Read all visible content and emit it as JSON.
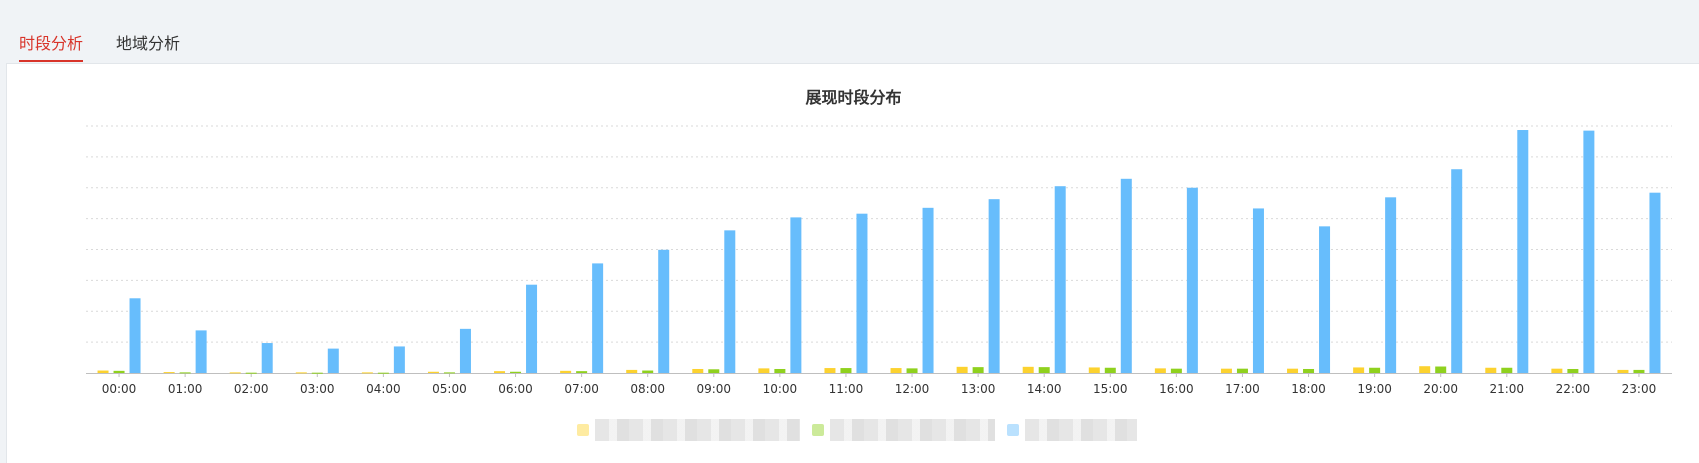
{
  "tabs": [
    {
      "label": "时段分析",
      "active": true
    },
    {
      "label": "地域分析",
      "active": false
    }
  ],
  "colors": {
    "active_tab": "#d8342a",
    "series_yellow": "#fcd22f",
    "series_green": "#8fd11e",
    "series_blue": "#67bdfc",
    "grid": "#d9d9d9",
    "axis": "#bfbfbf"
  },
  "chart_data": {
    "type": "bar",
    "title": "展现时段分布",
    "xlabel": "",
    "ylabel": "",
    "grid": true,
    "legend_position": "bottom",
    "categories": [
      "00:00",
      "01:00",
      "02:00",
      "03:00",
      "04:00",
      "05:00",
      "06:00",
      "07:00",
      "08:00",
      "09:00",
      "10:00",
      "11:00",
      "12:00",
      "13:00",
      "14:00",
      "15:00",
      "16:00",
      "17:00",
      "18:00",
      "19:00",
      "20:00",
      "21:00",
      "22:00",
      "23:00"
    ],
    "ylim": [
      0,
      8
    ],
    "series": [
      {
        "color": "#fcd22f",
        "values": [
          0.08,
          0.03,
          0.02,
          0.02,
          0.02,
          0.04,
          0.06,
          0.07,
          0.1,
          0.13,
          0.15,
          0.16,
          0.16,
          0.2,
          0.2,
          0.18,
          0.15,
          0.14,
          0.14,
          0.18,
          0.22,
          0.17,
          0.14,
          0.1
        ]
      },
      {
        "color": "#8fd11e",
        "values": [
          0.07,
          0.02,
          0.01,
          0.01,
          0.01,
          0.02,
          0.04,
          0.06,
          0.08,
          0.12,
          0.13,
          0.16,
          0.15,
          0.19,
          0.19,
          0.17,
          0.14,
          0.14,
          0.13,
          0.17,
          0.21,
          0.17,
          0.13,
          0.1
        ]
      },
      {
        "color": "#67bdfc",
        "values": [
          2.42,
          1.38,
          0.97,
          0.79,
          0.86,
          1.43,
          2.86,
          3.55,
          3.99,
          4.62,
          5.04,
          5.16,
          5.35,
          5.63,
          6.05,
          6.29,
          6.0,
          5.33,
          4.75,
          5.69,
          6.6,
          7.87,
          7.85,
          5.84
        ]
      }
    ]
  }
}
